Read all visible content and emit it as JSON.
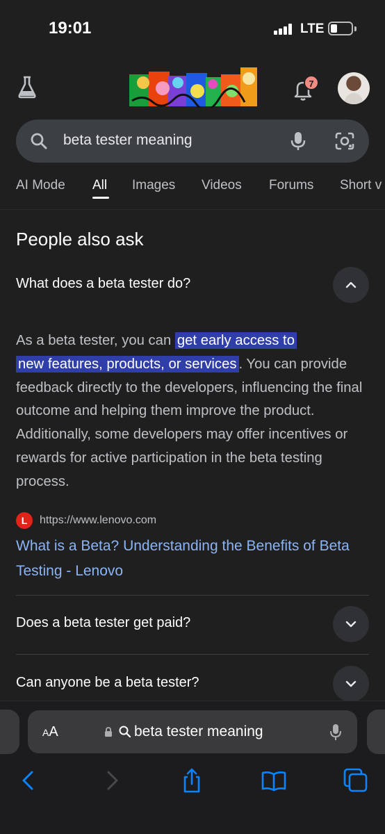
{
  "status_bar": {
    "time": "19:01",
    "network": "LTE"
  },
  "header": {
    "labs_icon": "flask-icon",
    "doodle": "google-doodle-logo",
    "notifications_count": "7",
    "avatar": "user-avatar"
  },
  "search": {
    "query": "beta tester meaning"
  },
  "tabs": [
    {
      "label": "AI Mode"
    },
    {
      "label": "All"
    },
    {
      "label": "Images"
    },
    {
      "label": "Videos"
    },
    {
      "label": "Forums"
    },
    {
      "label": "Short v"
    }
  ],
  "people_also_ask": {
    "title": "People also ask",
    "questions": [
      {
        "text": "What does a beta tester do?",
        "expanded": true
      },
      {
        "text": "Does a beta tester get paid?",
        "expanded": false
      },
      {
        "text": "Can anyone be a beta tester?",
        "expanded": false
      }
    ],
    "answer": {
      "before": "As a beta tester, you can ",
      "highlight_1": "get early access to",
      "highlight_2": "new features, products, or services",
      "after": ". You can provide feedback directly to the developers, influencing the final outcome and helping them improve the product. Additionally, some developers may offer incentives or rewards for active participation in the beta testing process."
    },
    "source": {
      "favicon_letter": "L",
      "url": "https://www.lenovo.com",
      "title": "What is a Beta? Understanding the Benefits of Beta Testing - Lenovo"
    }
  },
  "browser": {
    "aa_small": "A",
    "aa_large": "A",
    "address_text": "beta tester meaning"
  },
  "colors": {
    "background": "#1f1f1f",
    "link": "#8ab4f8",
    "highlight": "#2f3ea8",
    "ios_blue": "#0a84ff"
  }
}
